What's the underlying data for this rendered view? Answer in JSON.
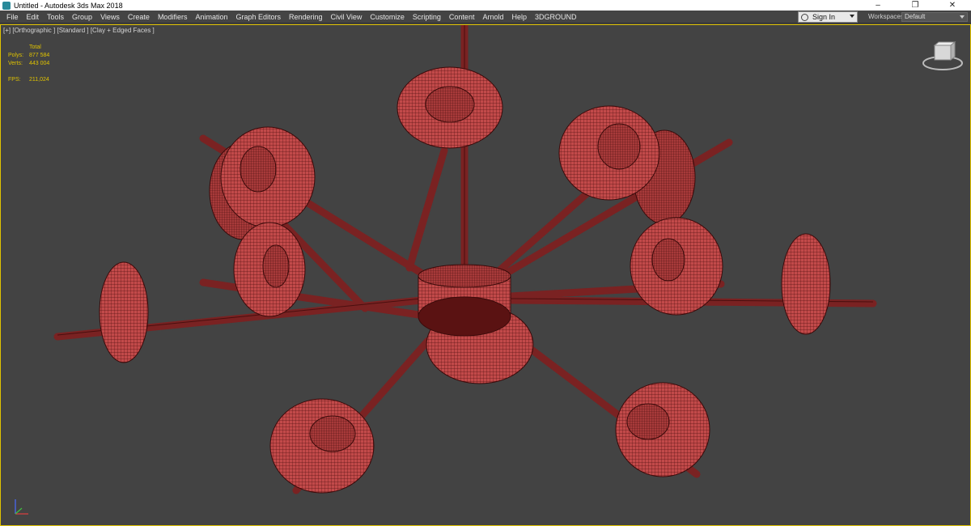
{
  "window": {
    "title": "Untitled - Autodesk 3ds Max 2018",
    "buttons": {
      "minimize": "–",
      "maximize": "❐",
      "close": "✕"
    }
  },
  "menu": {
    "items": [
      "File",
      "Edit",
      "Tools",
      "Group",
      "Views",
      "Create",
      "Modifiers",
      "Animation",
      "Graph Editors",
      "Rendering",
      "Civil View",
      "Customize",
      "Scripting",
      "Content",
      "Arnold",
      "Help",
      "3DGROUND"
    ],
    "sign_in": "Sign In",
    "workspaces_label": "Workspaces:",
    "workspace_value": "Default"
  },
  "viewport": {
    "label": "[+] [Orthographic ] [Standard ] [Clay + Edged Faces ]",
    "stats": {
      "header": "Total",
      "polys_label": "Polys:",
      "polys_value": "877 584",
      "verts_label": "Verts:",
      "verts_value": "443 004",
      "fps_label": "FPS:",
      "fps_value": "211,024"
    },
    "model_color": "#c24a4a",
    "border_color": "#e0c300"
  },
  "icons": {
    "app": "3dsmax-app-icon",
    "viewcube": "viewcube-icon",
    "axis": "axis-tripod-icon",
    "user": "user-icon"
  }
}
